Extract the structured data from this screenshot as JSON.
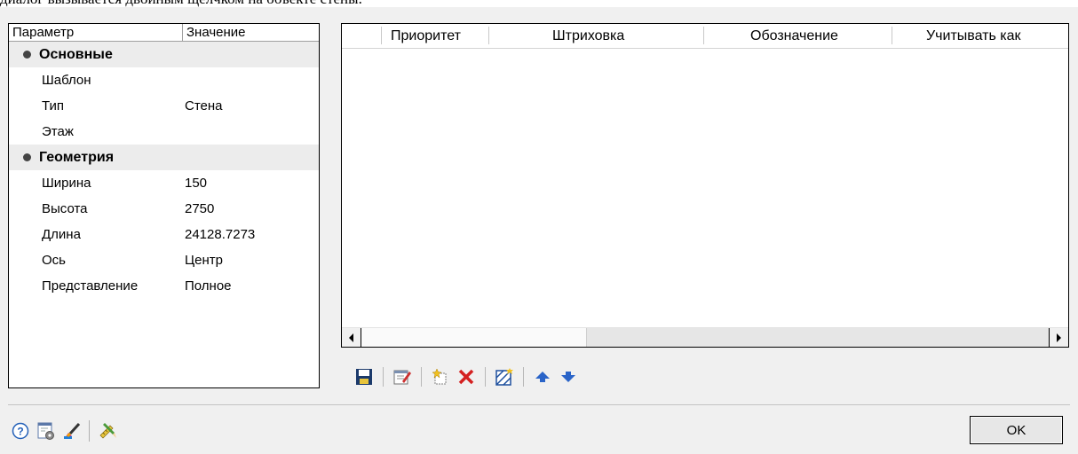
{
  "top_text": "диалог вызывается двойным щелчком на объекте стены.",
  "props": {
    "header": {
      "param": "Параметр",
      "value": "Значение"
    },
    "rows": [
      {
        "type": "group",
        "name": "Основные"
      },
      {
        "type": "item",
        "name": "Шаблон",
        "value": ""
      },
      {
        "type": "item",
        "name": "Тип",
        "value": "Стена"
      },
      {
        "type": "item",
        "name": "Этаж",
        "value": ""
      },
      {
        "type": "group",
        "name": "Геометрия"
      },
      {
        "type": "item",
        "name": "Ширина",
        "value": "150"
      },
      {
        "type": "item",
        "name": "Высота",
        "value": "2750"
      },
      {
        "type": "item",
        "name": "Длина",
        "value": "24128.7273"
      },
      {
        "type": "item",
        "name": "Ось",
        "value": "Центр"
      },
      {
        "type": "item",
        "name": "Представление",
        "value": "Полное"
      }
    ]
  },
  "grid": {
    "columns": [
      "Приоритет",
      "Штриховка",
      "Обозначение",
      "Учитывать как"
    ],
    "rows": []
  },
  "toolbar": {
    "icons": [
      "save-icon",
      "edit-properties-icon",
      "add-new-icon",
      "delete-icon",
      "select-hatch-icon",
      "move-up-icon",
      "move-down-icon"
    ]
  },
  "bottom_bar": {
    "icons": [
      "help-icon",
      "settings-icon",
      "paint-brush-icon",
      "pencil-ruler-icon"
    ]
  },
  "ok_label": "OK"
}
